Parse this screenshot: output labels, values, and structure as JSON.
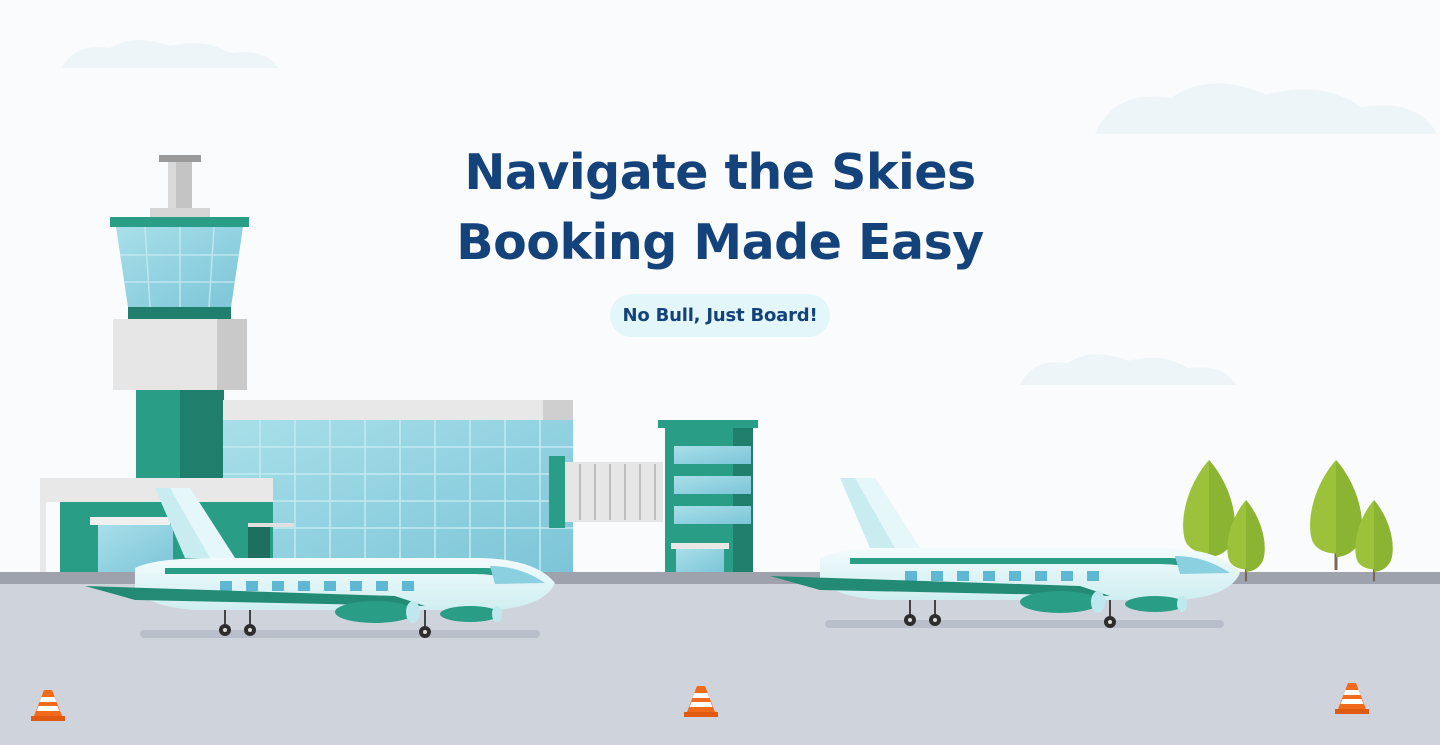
{
  "hero": {
    "title_line1": "Navigate the Skies",
    "title_line2": "Booking Made Easy",
    "tagline": "No Bull, Just Board!"
  },
  "colors": {
    "title": "#14427a",
    "tagline_bg": "#e3f6f9",
    "teal": "#2a9d86",
    "teal_dark": "#1f7f6c",
    "glass": "#8ad0e0",
    "tarmac": "#cfd4dc",
    "runway_edge": "#9da2ad",
    "tree": "#9cc13b",
    "cone": "#f26b1d"
  },
  "illustration": {
    "icons": [
      "control-tower-icon",
      "terminal-building-icon",
      "jet-bridge-icon",
      "airplane-icon",
      "tree-icon",
      "traffic-cone-icon",
      "cloud-icon"
    ]
  }
}
